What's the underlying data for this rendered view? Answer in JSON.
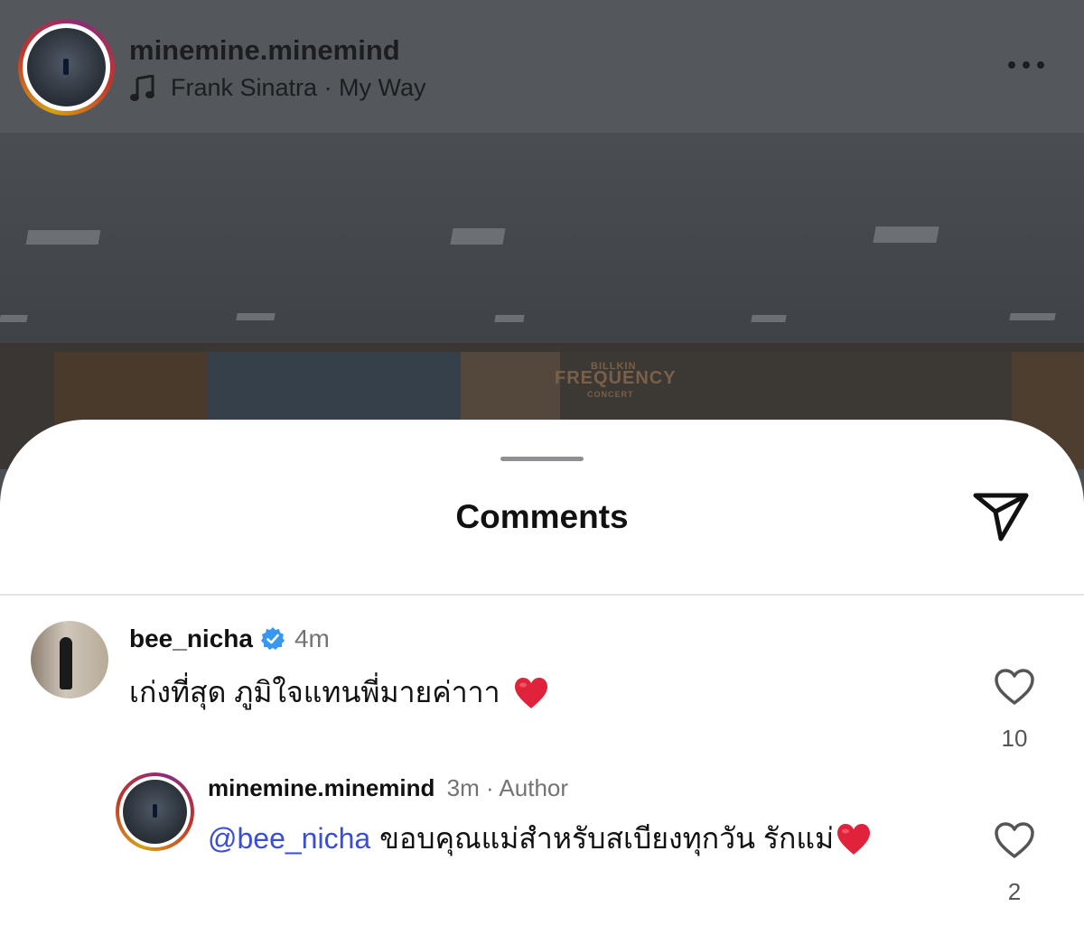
{
  "post": {
    "username": "minemine.minemind",
    "song": "Frank Sinatra · My Way",
    "banner_title": "BILLKIN",
    "banner_subtitle": "FREQUENCY",
    "banner_small": "CONCERT"
  },
  "sheet": {
    "title": "Comments"
  },
  "comments": [
    {
      "username": "bee_nicha",
      "verified": true,
      "time": "4m",
      "text": "เก่งที่สุด ภูมิใจแทนพี่มายค่าาา",
      "likes": "10",
      "replies": [
        {
          "username": "minemine.minemind",
          "time": "3m · Author",
          "mention": "@bee_nicha",
          "text": "ขอบคุณแม่สำหรับสเบียงทุกวัน รักแม่",
          "likes": "2"
        }
      ]
    }
  ],
  "icons": {
    "more": "more-horizontal-icon",
    "music": "music-note-icon",
    "share": "paper-plane-icon",
    "verified": "verified-badge-icon",
    "like": "heart-outline-icon",
    "emoji": "red-heart-emoji"
  },
  "colors": {
    "verified_blue": "#3897f0",
    "mention_blue": "#3a4dd6",
    "heart_red": "#e0223a"
  }
}
